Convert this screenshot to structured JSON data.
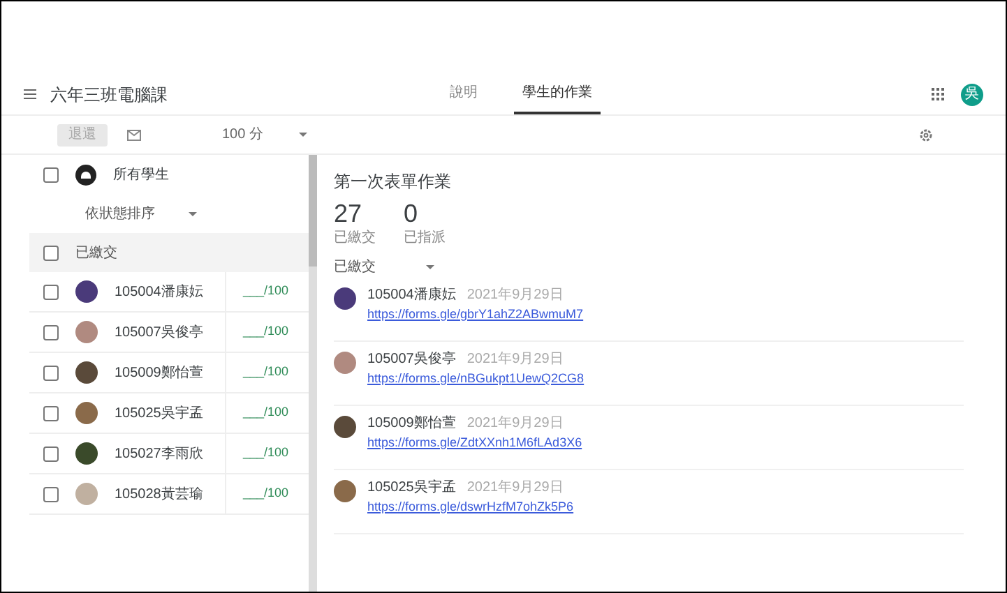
{
  "header": {
    "title": "六年三班電腦課",
    "tabs": [
      {
        "label": "說明",
        "selected": false
      },
      {
        "label": "學生的作業",
        "selected": true
      }
    ],
    "account_initials": "吳"
  },
  "toolbar": {
    "return_button": {
      "label": "退還",
      "disabled": true
    },
    "points": "100 分"
  },
  "roster": {
    "all_students": {
      "label": "所有學生",
      "checked": false
    },
    "sort": "依狀態排序",
    "group": {
      "label": "已繳交",
      "checked": false
    },
    "students": [
      {
        "name": "105004潘康妘",
        "grade": "___/100",
        "checked": false,
        "color": "#4a3a7a"
      },
      {
        "name": "105007吳俊亭",
        "grade": "___/100",
        "checked": false,
        "color": "#b08a80"
      },
      {
        "name": "105009鄭怡萱",
        "grade": "___/100",
        "checked": false,
        "color": "#5a4a3a"
      },
      {
        "name": "105025吳宇孟",
        "grade": "___/100",
        "checked": false,
        "color": "#8a6a4a"
      },
      {
        "name": "105027李雨欣",
        "grade": "___/100",
        "checked": false,
        "color": "#3a4a2a"
      },
      {
        "name": "105028黃芸瑜",
        "grade": "___/100",
        "checked": false,
        "color": "#c0b0a0"
      }
    ]
  },
  "assignment": {
    "title": "第一次表單作業",
    "stats": [
      {
        "count": "27",
        "label": "已繳交"
      },
      {
        "count": "0",
        "label": "已指派"
      }
    ],
    "filter": "已繳交",
    "submissions": [
      {
        "name": "105004潘康妘",
        "date": "2021年9月29日",
        "link": "https://forms.gle/gbrY1ahZ2ABwmuM7",
        "color": "#4a3a7a"
      },
      {
        "name": "105007吳俊亭",
        "date": "2021年9月29日",
        "link": "https://forms.gle/nBGukpt1UewQ2CG8",
        "color": "#b08a80"
      },
      {
        "name": "105009鄭怡萱",
        "date": "2021年9月29日",
        "link": "https://forms.gle/ZdtXXnh1M6fLAd3X6",
        "color": "#5a4a3a"
      },
      {
        "name": "105025吳宇孟",
        "date": "2021年9月29日",
        "link": "https://forms.gle/dswrHzfM7ohZk5P6",
        "color": "#8a6a4a"
      }
    ]
  }
}
